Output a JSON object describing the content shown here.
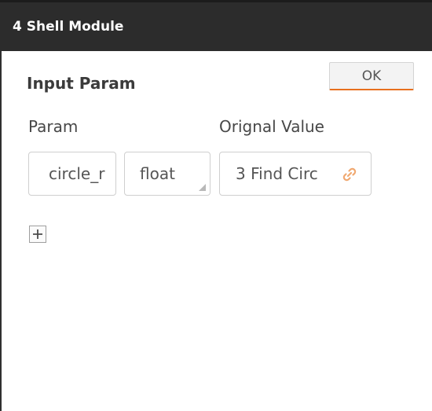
{
  "window": {
    "title": "4 Shell Module"
  },
  "section": {
    "title": "Input Param",
    "ok_label": "OK"
  },
  "columns": {
    "param": "Param",
    "original_value": "Orignal Value"
  },
  "params": [
    {
      "name": "circle_r",
      "type": "float",
      "original_value": "3 Find Circ"
    }
  ],
  "icons": {
    "link": "link-icon",
    "add": "plus-icon",
    "dropdown": "dropdown-corner-icon"
  },
  "colors": {
    "titlebar": "#2c2c2c",
    "accent": "#e8701e",
    "link_icon": "#f0a870"
  }
}
